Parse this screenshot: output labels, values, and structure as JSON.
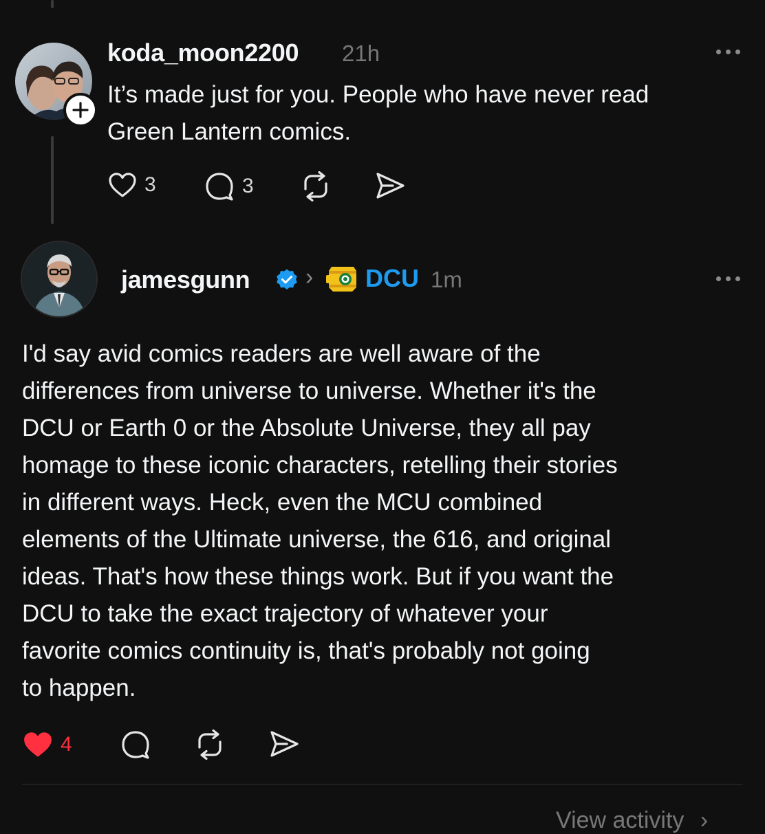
{
  "reply": {
    "username": "koda_moon2200",
    "time": "21h",
    "lines": [
      "It’s made just for you. People who have never read",
      "Green Lantern comics."
    ],
    "likes": "3",
    "comments": "3",
    "follow_badge": "+"
  },
  "post": {
    "username": "jamesgunn",
    "verified_icon": "verified-badge-icon",
    "separator": "›",
    "community": "DCU",
    "community_icon": "green-lantern-lantern-icon",
    "time": "1m",
    "lines": [
      "I'd say avid comics readers are well aware of the",
      "differences from universe to universe. Whether it's the",
      "DCU or Earth 0 or the Absolute Universe, they all pay",
      "homage to these iconic characters, retelling their stories",
      "in different ways. Heck, even the MCU combined",
      "elements of the Ultimate universe, the 616, and original",
      "ideas. That's how these things work. But if you want the",
      "DCU to take the exact trajectory of whatever your",
      "favorite comics continuity is, that's probably not going",
      "to happen."
    ],
    "likes": "4",
    "liked": true
  },
  "footer": {
    "view_activity": "View activity",
    "chevron": "›"
  },
  "colors": {
    "background": "#101010",
    "text": "#f3f5f7",
    "muted": "#777777",
    "like_red": "#ff3040",
    "community_blue": "#1d9bf0"
  }
}
